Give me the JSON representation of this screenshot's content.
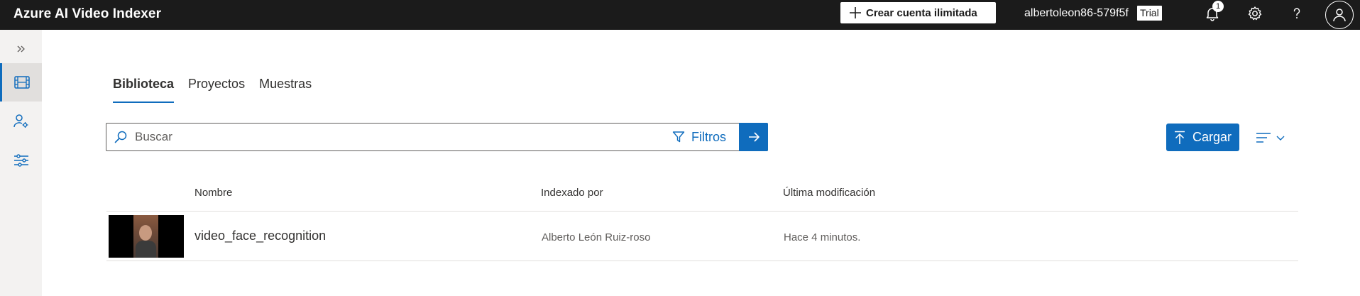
{
  "header": {
    "brand": "Azure AI Video Indexer",
    "create_button": "Crear cuenta ilimitada",
    "account_name": "albertoleon86-579f5f",
    "account_tier": "Trial",
    "notification_count": "1",
    "icons": [
      "bell-icon",
      "gear-icon",
      "help-icon",
      "user-icon"
    ]
  },
  "sidebar": {
    "items": [
      {
        "name": "expand",
        "icon": "chevron-double-right-icon"
      },
      {
        "name": "library",
        "icon": "film-icon",
        "active": true
      },
      {
        "name": "account-settings",
        "icon": "person-settings-icon"
      },
      {
        "name": "model-customization",
        "icon": "sliders-icon"
      }
    ]
  },
  "main": {
    "tabs": [
      {
        "label": "Biblioteca",
        "active": true
      },
      {
        "label": "Proyectos"
      },
      {
        "label": "Muestras"
      }
    ],
    "search": {
      "placeholder": "Buscar",
      "value": ""
    },
    "filters_label": "Filtros",
    "upload_label": "Cargar",
    "table": {
      "columns": [
        "Nombre",
        "Indexado por",
        "Última modificación"
      ],
      "rows": [
        {
          "name": "video_face_recognition",
          "indexed_by": "Alberto León Ruiz-roso",
          "modified": "Hace 4 minutos."
        }
      ]
    }
  },
  "colors": {
    "topbar": "#1b1b1b",
    "accent": "#0f6cbd",
    "rail": "#f3f2f1"
  }
}
